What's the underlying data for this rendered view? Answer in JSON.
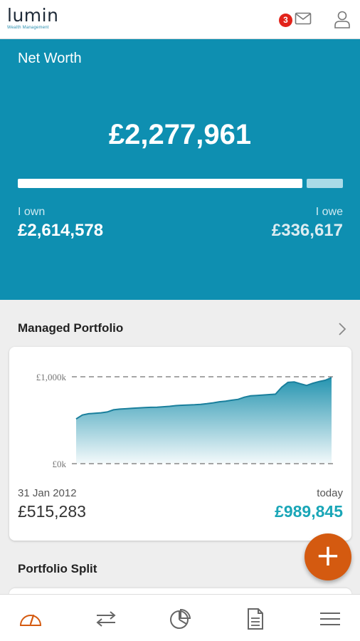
{
  "app": {
    "logo_text": "lumin",
    "logo_subtitle": "Wealth Management",
    "notification_count": "3"
  },
  "net_worth": {
    "title": "Net Worth",
    "amount": "£2,277,961",
    "own_label": "I own",
    "own_value": "£2,614,578",
    "owe_label": "I owe",
    "owe_value": "£336,617",
    "own_fraction": 0.886,
    "colors": {
      "background": "#0e8fb1",
      "own_bar": "#ffffff",
      "owe_bar": "#a9dbe8"
    }
  },
  "managed_portfolio": {
    "title": "Managed Portfolio",
    "y_top_label": "£1,000k",
    "y_bottom_label": "£0k",
    "start_date": "31 Jan 2012",
    "start_value": "£515,283",
    "end_label": "today",
    "end_value": "£989,845",
    "accent_color": "#1aa6b7"
  },
  "chart_data": {
    "type": "area",
    "ylim": [
      0,
      1000
    ],
    "y_unit": "£k",
    "grid": "dashed lines at top and bottom",
    "y_tick_labels": [
      "£1,000k",
      "£0k"
    ],
    "x_range_labels": [
      "31 Jan 2012",
      "today"
    ],
    "series": [
      {
        "values": [
          515,
          560,
          575,
          580,
          585,
          595,
          620,
          628,
          632,
          638,
          642,
          645,
          648,
          650,
          655,
          660,
          668,
          672,
          675,
          678,
          682,
          690,
          700,
          712,
          720,
          730,
          740,
          765,
          780,
          785,
          790,
          795,
          800,
          880,
          935,
          940,
          920,
          900,
          925,
          945,
          960,
          990
        ]
      }
    ]
  },
  "portfolio_split": {
    "title": "Portfolio Split"
  },
  "fab": {
    "label": "+"
  },
  "bottom_nav": {
    "items": [
      {
        "icon": "dashboard-gauge-icon",
        "active": true
      },
      {
        "icon": "transfer-arrows-icon",
        "active": false
      },
      {
        "icon": "pie-chart-icon",
        "active": false
      },
      {
        "icon": "document-icon",
        "active": false
      },
      {
        "icon": "menu-icon",
        "active": false
      }
    ],
    "active_color": "#d45a10",
    "inactive_color": "#666666"
  }
}
